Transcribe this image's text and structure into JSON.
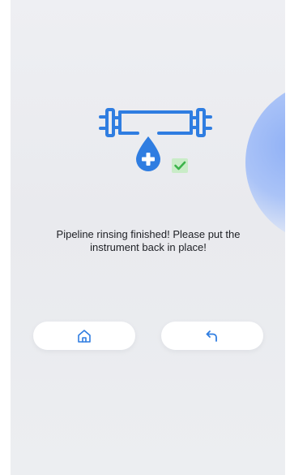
{
  "message": {
    "line1": "Pipeline rinsing finished! Please put the",
    "line2": "instrument back in place!"
  },
  "icons": {
    "pipe": "pipe-icon",
    "drop": "water-drop-plus-icon",
    "check": "check-badge-icon",
    "home": "home-icon",
    "back": "return-arrow-icon"
  },
  "colors": {
    "accent": "#2f7de1",
    "check_bg": "#c9ecc7",
    "check_mark": "#3bb34a",
    "text": "#1d1f24",
    "button_bg": "#ffffff",
    "glow": "#8fb0f6"
  }
}
